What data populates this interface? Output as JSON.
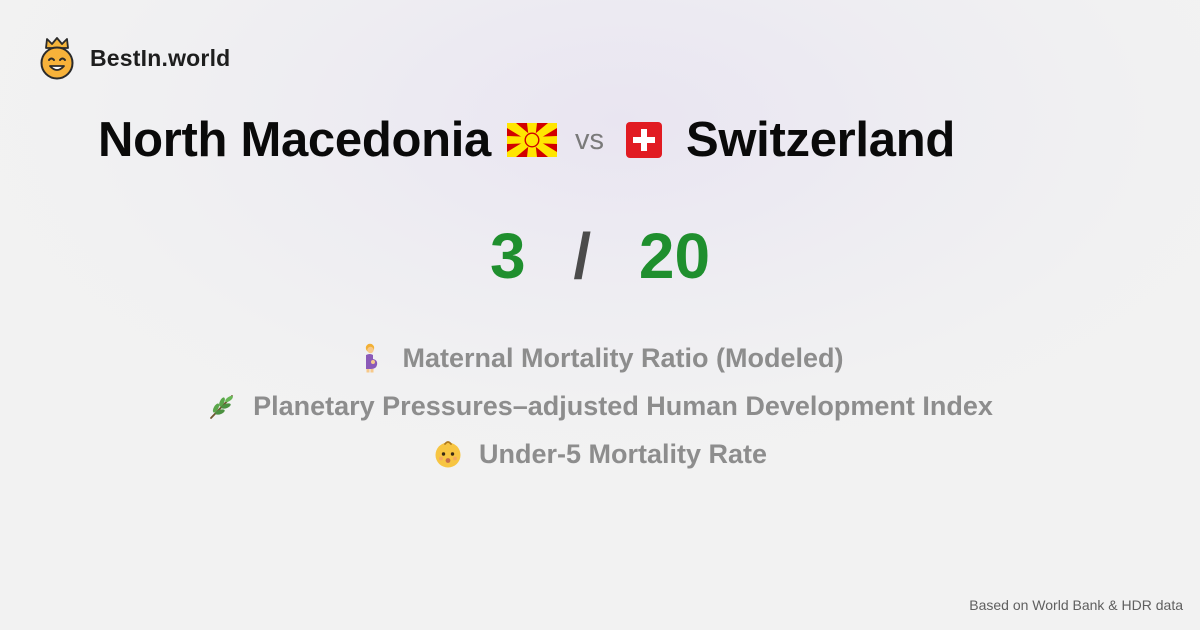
{
  "brand": {
    "name": "BestIn.world",
    "logo_icon": "crowned-smiley-icon"
  },
  "comparison": {
    "country_a": "North Macedonia",
    "country_b": "Switzerland",
    "vs_label": "vs",
    "flag_a_icon": "north-macedonia-flag-icon",
    "flag_b_icon": "switzerland-flag-icon"
  },
  "score": {
    "a": "3",
    "separator": "/",
    "b": "20",
    "color": "#1f8f2e"
  },
  "metrics": [
    {
      "icon": "pregnant-woman-icon",
      "label": "Maternal Mortality Ratio (Modeled)"
    },
    {
      "icon": "leafy-branch-icon",
      "label": "Planetary Pressures–adjusted Human Development Index"
    },
    {
      "icon": "baby-face-icon",
      "label": "Under-5 Mortality Rate"
    }
  ],
  "footer": {
    "source": "Based on World Bank & HDR data"
  }
}
